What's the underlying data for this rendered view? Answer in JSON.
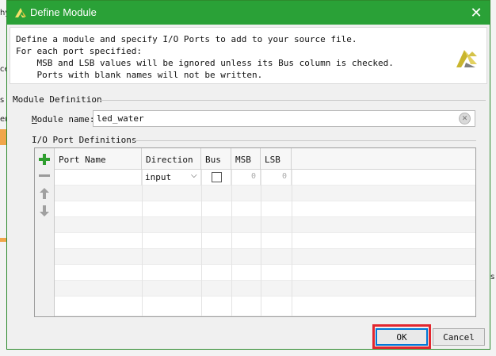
{
  "dialog": {
    "title": "Define Module",
    "close_glyph": "✕"
  },
  "description": {
    "line1": "Define a module and specify I/O Ports to add to your source file.",
    "line2": "For each port specified:",
    "line3": "    MSB and LSB values will be ignored unless its Bus column is checked.",
    "line4": "    Ports with blank names will not be written."
  },
  "module_definition": {
    "section_label": "Module Definition",
    "name_label_prefix": "M",
    "name_label_rest": "odule name:",
    "name_value": "led_water"
  },
  "io_ports": {
    "section_label": "I/O Port Definitions",
    "columns": [
      "Port Name",
      "Direction",
      "Bus",
      "MSB",
      "LSB"
    ],
    "first_row": {
      "port_name": "",
      "direction": "input",
      "bus_checked": false,
      "msb": "0",
      "lsb": "0"
    },
    "toolbar": [
      "add-icon",
      "remove-icon",
      "move-up-icon",
      "move-down-icon"
    ]
  },
  "buttons": {
    "ok": "OK",
    "cancel": "Cancel"
  },
  "background": {
    "fragments": [
      "hy",
      "ce",
      "s",
      "em",
      "s"
    ]
  },
  "colors": {
    "titlebar": "#2aa137",
    "highlight": "#e2272f",
    "add_icon": "#2f9e2f"
  }
}
